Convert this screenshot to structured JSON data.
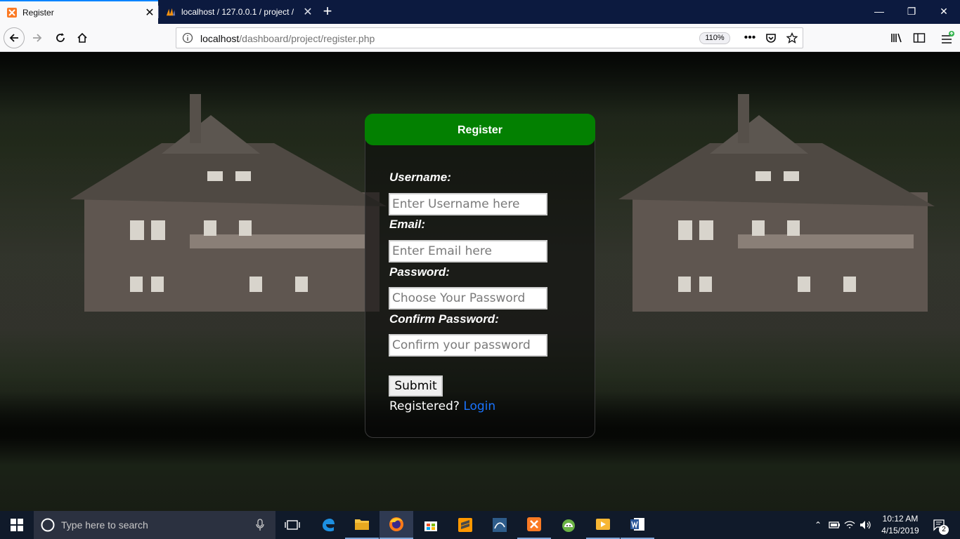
{
  "browser": {
    "tabs": [
      {
        "title": "Register",
        "active": true
      },
      {
        "title": "localhost / 127.0.0.1 / project / ",
        "active": false
      }
    ],
    "url_host": "localhost",
    "url_path": "/dashboard/project/register.php",
    "zoom": "110%"
  },
  "form": {
    "title": "Register",
    "username_label": "Username:",
    "username_placeholder": "Enter Username here",
    "email_label": "Email:",
    "email_placeholder": "Enter Email here",
    "password_label": "Password:",
    "password_placeholder": "Choose Your Password",
    "confirm_label": "Confirm Password:",
    "confirm_placeholder": "Confirm your password",
    "submit_label": "Submit",
    "registered_text": "Registered?",
    "login_link": "Login"
  },
  "taskbar": {
    "search_placeholder": "Type here to search",
    "time": "10:12 AM",
    "date": "4/15/2019",
    "notification_count": "2"
  },
  "colors": {
    "header_green": "#038001",
    "link_blue": "#1a74ff",
    "tabbar": "#0c1a3f",
    "taskbar": "#101a2a"
  }
}
